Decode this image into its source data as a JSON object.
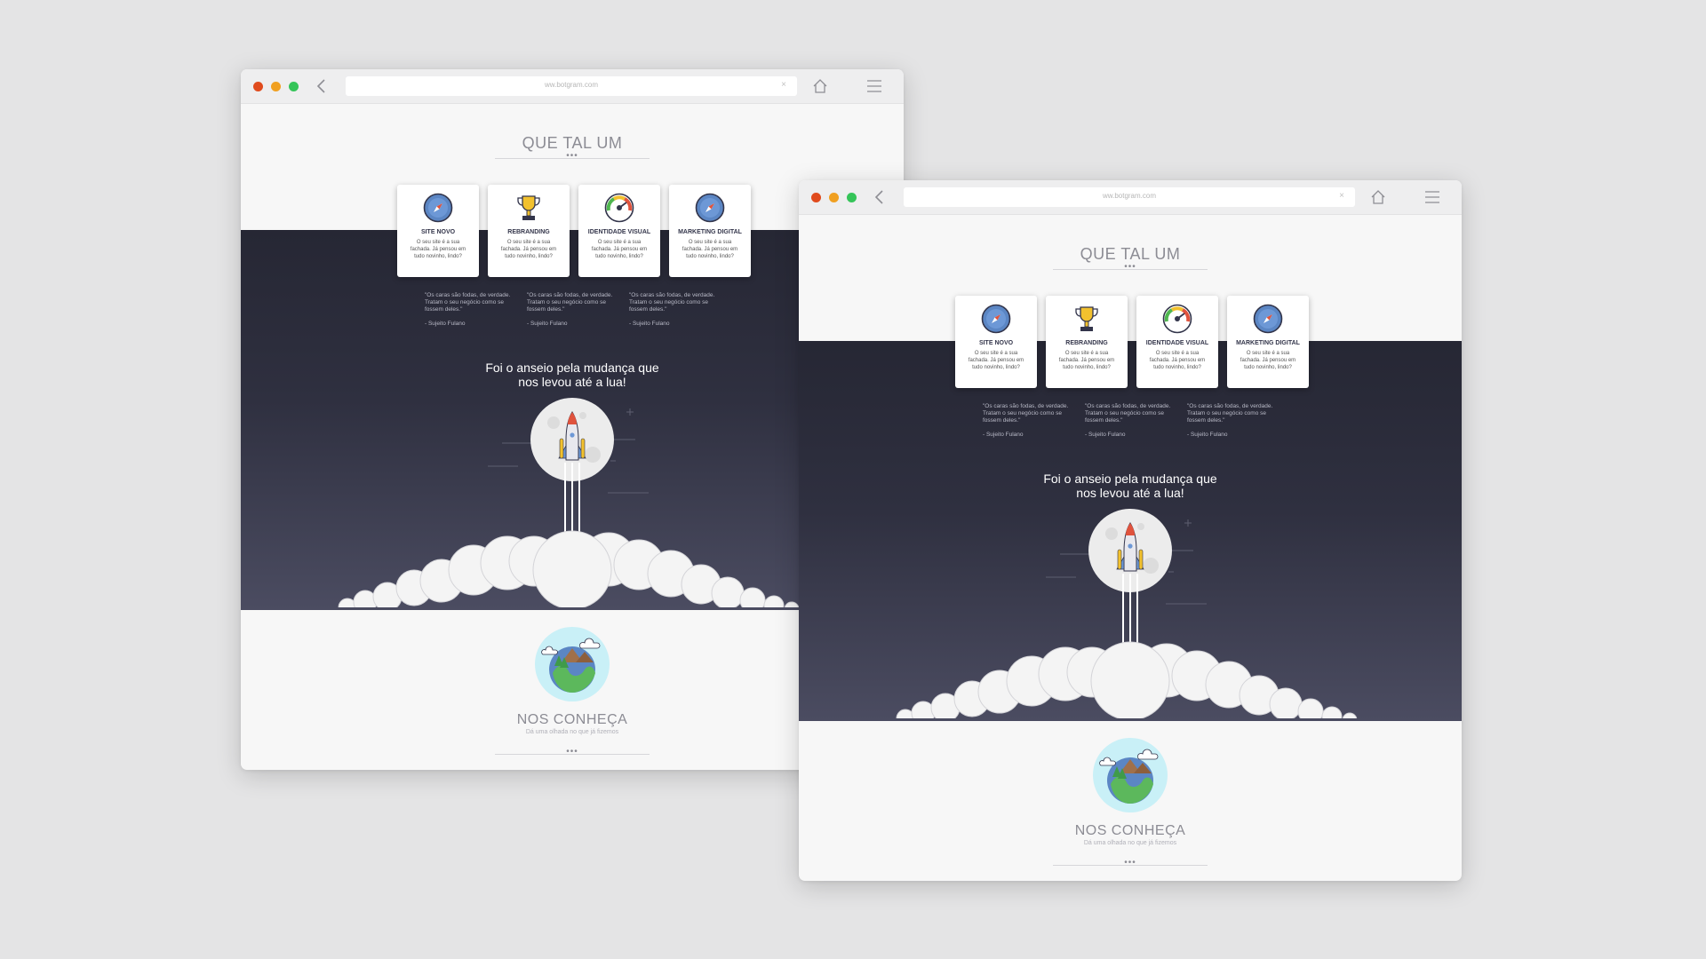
{
  "browser": {
    "url": "ww.botgram.com",
    "close_glyph": "×"
  },
  "page": {
    "title": "QUE TAL UM",
    "cards": [
      {
        "icon": "compass-icon",
        "title": "SITE NOVO",
        "description": "O seu site é a sua fachada. Já pensou em tudo novinho, lindo?"
      },
      {
        "icon": "trophy-icon",
        "title": "REBRANDING",
        "description": "O seu site é a sua fachada. Já pensou em tudo novinho, lindo?"
      },
      {
        "icon": "gauge-icon",
        "title": "IDENTIDADE VISUAL",
        "description": "O seu site é a sua fachada. Já pensou em tudo novinho, lindo?"
      },
      {
        "icon": "compass-icon",
        "title": "MARKETING DIGITAL",
        "description": "O seu site é a sua fachada. Já pensou em tudo novinho, lindo?"
      }
    ],
    "quotes": [
      {
        "text": "\"Os caras são fodas, de verdade. Tratam o seu negócio como se fossem deles.\"",
        "author": "- Sujeito Fulano"
      },
      {
        "text": "\"Os caras são fodas, de verdade. Tratam o seu negócio como se fossem deles.\"",
        "author": "- Sujeito Fulano"
      },
      {
        "text": "\"Os caras são fodas, de verdade. Tratam o seu negócio como se fossem deles.\"",
        "author": "- Sujeito Fulano"
      }
    ],
    "tagline": "Foi o anseio pela mudança que nos levou até a lua!",
    "about_title": "NOS CONHEÇA",
    "about_subtitle": "Dá uma olhada no que já fizemos",
    "separator_dots": "•••"
  },
  "colors": {
    "dark_band": "#262734",
    "dot_red": "#e04b1d",
    "dot_yellow": "#f0a021",
    "dot_green": "#35c459"
  }
}
